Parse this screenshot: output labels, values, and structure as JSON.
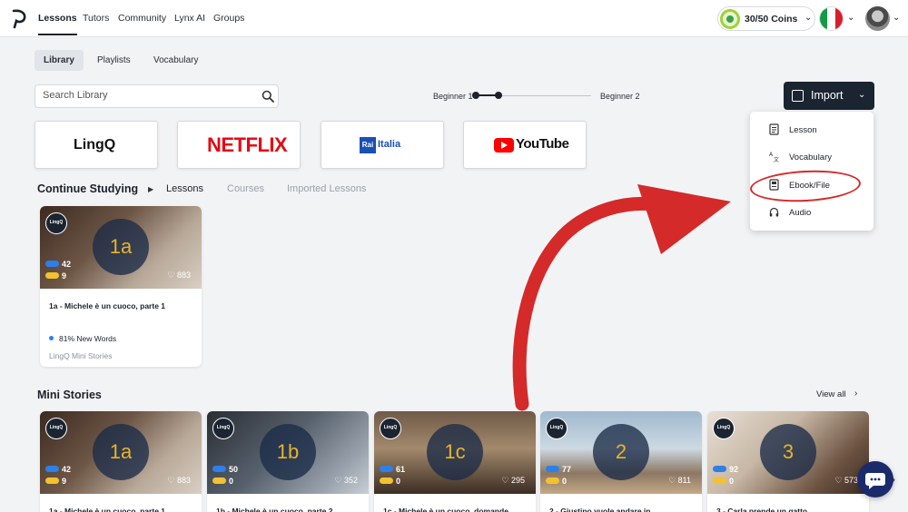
{
  "nav": {
    "links": [
      "Lessons",
      "Tutors",
      "Community",
      "Lynx AI",
      "Groups"
    ],
    "coins": "30/50 Coins",
    "flag_colors": [
      "#119b45",
      "#ffffff",
      "#d71f2b"
    ]
  },
  "subtabs": [
    "Library",
    "Playlists",
    "Vocabulary"
  ],
  "search": {
    "placeholder": "Search Library"
  },
  "level": {
    "from": "Beginner 1",
    "to": "Beginner 2"
  },
  "import": {
    "label": "Import",
    "menu": [
      "Lesson",
      "Vocabulary",
      "Ebook/File",
      "Audio"
    ]
  },
  "sources": {
    "lingq": "LingQ",
    "netflix": "NETFLIX",
    "rai_box": "Rai",
    "rai_text": "Italia",
    "youtube": "YouTube"
  },
  "continue": {
    "title": "Continue Studying",
    "tabs": [
      "Lessons",
      "Courses",
      "Imported Lessons"
    ]
  },
  "continue_card": {
    "badge": "1a",
    "blue": "42",
    "yellow": "9",
    "likes": "883",
    "title": "1a - Michele è un cuoco, parte 1",
    "new_words": "81% New Words",
    "course": "LingQ Mini Stories"
  },
  "mini": {
    "title": "Mini Stories",
    "view_all": "View all",
    "cards": [
      {
        "badge": "1a",
        "blue": "42",
        "yellow": "9",
        "likes": "883",
        "title": "1a - Michele è un cuoco, parte 1"
      },
      {
        "badge": "1b",
        "blue": "50",
        "yellow": "0",
        "likes": "352",
        "title": "1b - Michele è un cuoco, parte 2"
      },
      {
        "badge": "1c",
        "blue": "61",
        "yellow": "0",
        "likes": "295",
        "title": "1c - Michele è un cuoco, domande"
      },
      {
        "badge": "2",
        "blue": "77",
        "yellow": "0",
        "likes": "811",
        "title": "2 - Giustino vuole andare in"
      },
      {
        "badge": "3",
        "blue": "92",
        "yellow": "0",
        "likes": "573",
        "title": "3 - Carla prende un gatto"
      }
    ]
  },
  "logo_text": "LingQ",
  "colors": {
    "accent_blue": "#2e7fe8",
    "word_yellow": "#f2c230",
    "import_bg": "#1b2431",
    "annotation_red": "#d42a2a"
  }
}
